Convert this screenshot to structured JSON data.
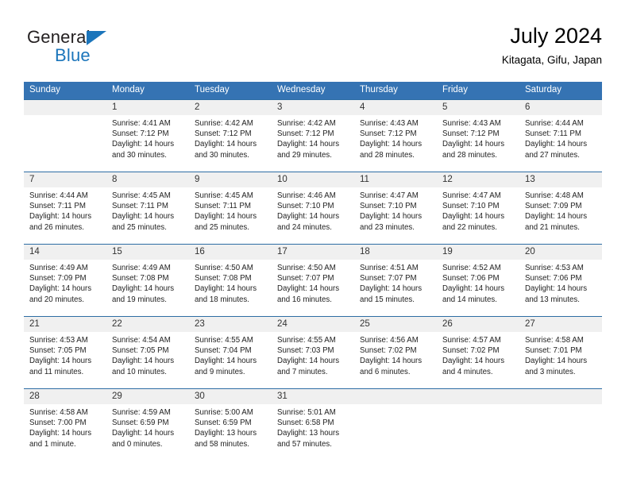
{
  "brand": {
    "name_top": "General",
    "name_bottom": "Blue",
    "accent_color": "#1b75bb"
  },
  "header": {
    "title": "July 2024",
    "subtitle": "Kitagata, Gifu, Japan"
  },
  "theme": {
    "header_row_bg": "#3573b3",
    "header_row_text": "#ffffff",
    "daynum_bg": "#f0f0f0",
    "row_divider": "#2e6da4"
  },
  "labels": {
    "sunrise_prefix": "Sunrise:",
    "sunset_prefix": "Sunset:",
    "daylight_prefix": "Daylight:"
  },
  "weekday_headers": [
    "Sunday",
    "Monday",
    "Tuesday",
    "Wednesday",
    "Thursday",
    "Friday",
    "Saturday"
  ],
  "weeks": [
    [
      {
        "day": "",
        "sunrise": "",
        "sunset": "",
        "daylight_line1": "",
        "daylight_line2": ""
      },
      {
        "day": "1",
        "sunrise": "Sunrise: 4:41 AM",
        "sunset": "Sunset: 7:12 PM",
        "daylight_line1": "Daylight: 14 hours",
        "daylight_line2": "and 30 minutes."
      },
      {
        "day": "2",
        "sunrise": "Sunrise: 4:42 AM",
        "sunset": "Sunset: 7:12 PM",
        "daylight_line1": "Daylight: 14 hours",
        "daylight_line2": "and 30 minutes."
      },
      {
        "day": "3",
        "sunrise": "Sunrise: 4:42 AM",
        "sunset": "Sunset: 7:12 PM",
        "daylight_line1": "Daylight: 14 hours",
        "daylight_line2": "and 29 minutes."
      },
      {
        "day": "4",
        "sunrise": "Sunrise: 4:43 AM",
        "sunset": "Sunset: 7:12 PM",
        "daylight_line1": "Daylight: 14 hours",
        "daylight_line2": "and 28 minutes."
      },
      {
        "day": "5",
        "sunrise": "Sunrise: 4:43 AM",
        "sunset": "Sunset: 7:12 PM",
        "daylight_line1": "Daylight: 14 hours",
        "daylight_line2": "and 28 minutes."
      },
      {
        "day": "6",
        "sunrise": "Sunrise: 4:44 AM",
        "sunset": "Sunset: 7:11 PM",
        "daylight_line1": "Daylight: 14 hours",
        "daylight_line2": "and 27 minutes."
      }
    ],
    [
      {
        "day": "7",
        "sunrise": "Sunrise: 4:44 AM",
        "sunset": "Sunset: 7:11 PM",
        "daylight_line1": "Daylight: 14 hours",
        "daylight_line2": "and 26 minutes."
      },
      {
        "day": "8",
        "sunrise": "Sunrise: 4:45 AM",
        "sunset": "Sunset: 7:11 PM",
        "daylight_line1": "Daylight: 14 hours",
        "daylight_line2": "and 25 minutes."
      },
      {
        "day": "9",
        "sunrise": "Sunrise: 4:45 AM",
        "sunset": "Sunset: 7:11 PM",
        "daylight_line1": "Daylight: 14 hours",
        "daylight_line2": "and 25 minutes."
      },
      {
        "day": "10",
        "sunrise": "Sunrise: 4:46 AM",
        "sunset": "Sunset: 7:10 PM",
        "daylight_line1": "Daylight: 14 hours",
        "daylight_line2": "and 24 minutes."
      },
      {
        "day": "11",
        "sunrise": "Sunrise: 4:47 AM",
        "sunset": "Sunset: 7:10 PM",
        "daylight_line1": "Daylight: 14 hours",
        "daylight_line2": "and 23 minutes."
      },
      {
        "day": "12",
        "sunrise": "Sunrise: 4:47 AM",
        "sunset": "Sunset: 7:10 PM",
        "daylight_line1": "Daylight: 14 hours",
        "daylight_line2": "and 22 minutes."
      },
      {
        "day": "13",
        "sunrise": "Sunrise: 4:48 AM",
        "sunset": "Sunset: 7:09 PM",
        "daylight_line1": "Daylight: 14 hours",
        "daylight_line2": "and 21 minutes."
      }
    ],
    [
      {
        "day": "14",
        "sunrise": "Sunrise: 4:49 AM",
        "sunset": "Sunset: 7:09 PM",
        "daylight_line1": "Daylight: 14 hours",
        "daylight_line2": "and 20 minutes."
      },
      {
        "day": "15",
        "sunrise": "Sunrise: 4:49 AM",
        "sunset": "Sunset: 7:08 PM",
        "daylight_line1": "Daylight: 14 hours",
        "daylight_line2": "and 19 minutes."
      },
      {
        "day": "16",
        "sunrise": "Sunrise: 4:50 AM",
        "sunset": "Sunset: 7:08 PM",
        "daylight_line1": "Daylight: 14 hours",
        "daylight_line2": "and 18 minutes."
      },
      {
        "day": "17",
        "sunrise": "Sunrise: 4:50 AM",
        "sunset": "Sunset: 7:07 PM",
        "daylight_line1": "Daylight: 14 hours",
        "daylight_line2": "and 16 minutes."
      },
      {
        "day": "18",
        "sunrise": "Sunrise: 4:51 AM",
        "sunset": "Sunset: 7:07 PM",
        "daylight_line1": "Daylight: 14 hours",
        "daylight_line2": "and 15 minutes."
      },
      {
        "day": "19",
        "sunrise": "Sunrise: 4:52 AM",
        "sunset": "Sunset: 7:06 PM",
        "daylight_line1": "Daylight: 14 hours",
        "daylight_line2": "and 14 minutes."
      },
      {
        "day": "20",
        "sunrise": "Sunrise: 4:53 AM",
        "sunset": "Sunset: 7:06 PM",
        "daylight_line1": "Daylight: 14 hours",
        "daylight_line2": "and 13 minutes."
      }
    ],
    [
      {
        "day": "21",
        "sunrise": "Sunrise: 4:53 AM",
        "sunset": "Sunset: 7:05 PM",
        "daylight_line1": "Daylight: 14 hours",
        "daylight_line2": "and 11 minutes."
      },
      {
        "day": "22",
        "sunrise": "Sunrise: 4:54 AM",
        "sunset": "Sunset: 7:05 PM",
        "daylight_line1": "Daylight: 14 hours",
        "daylight_line2": "and 10 minutes."
      },
      {
        "day": "23",
        "sunrise": "Sunrise: 4:55 AM",
        "sunset": "Sunset: 7:04 PM",
        "daylight_line1": "Daylight: 14 hours",
        "daylight_line2": "and 9 minutes."
      },
      {
        "day": "24",
        "sunrise": "Sunrise: 4:55 AM",
        "sunset": "Sunset: 7:03 PM",
        "daylight_line1": "Daylight: 14 hours",
        "daylight_line2": "and 7 minutes."
      },
      {
        "day": "25",
        "sunrise": "Sunrise: 4:56 AM",
        "sunset": "Sunset: 7:02 PM",
        "daylight_line1": "Daylight: 14 hours",
        "daylight_line2": "and 6 minutes."
      },
      {
        "day": "26",
        "sunrise": "Sunrise: 4:57 AM",
        "sunset": "Sunset: 7:02 PM",
        "daylight_line1": "Daylight: 14 hours",
        "daylight_line2": "and 4 minutes."
      },
      {
        "day": "27",
        "sunrise": "Sunrise: 4:58 AM",
        "sunset": "Sunset: 7:01 PM",
        "daylight_line1": "Daylight: 14 hours",
        "daylight_line2": "and 3 minutes."
      }
    ],
    [
      {
        "day": "28",
        "sunrise": "Sunrise: 4:58 AM",
        "sunset": "Sunset: 7:00 PM",
        "daylight_line1": "Daylight: 14 hours",
        "daylight_line2": "and 1 minute."
      },
      {
        "day": "29",
        "sunrise": "Sunrise: 4:59 AM",
        "sunset": "Sunset: 6:59 PM",
        "daylight_line1": "Daylight: 14 hours",
        "daylight_line2": "and 0 minutes."
      },
      {
        "day": "30",
        "sunrise": "Sunrise: 5:00 AM",
        "sunset": "Sunset: 6:59 PM",
        "daylight_line1": "Daylight: 13 hours",
        "daylight_line2": "and 58 minutes."
      },
      {
        "day": "31",
        "sunrise": "Sunrise: 5:01 AM",
        "sunset": "Sunset: 6:58 PM",
        "daylight_line1": "Daylight: 13 hours",
        "daylight_line2": "and 57 minutes."
      },
      {
        "day": "",
        "sunrise": "",
        "sunset": "",
        "daylight_line1": "",
        "daylight_line2": ""
      },
      {
        "day": "",
        "sunrise": "",
        "sunset": "",
        "daylight_line1": "",
        "daylight_line2": ""
      },
      {
        "day": "",
        "sunrise": "",
        "sunset": "",
        "daylight_line1": "",
        "daylight_line2": ""
      }
    ]
  ]
}
